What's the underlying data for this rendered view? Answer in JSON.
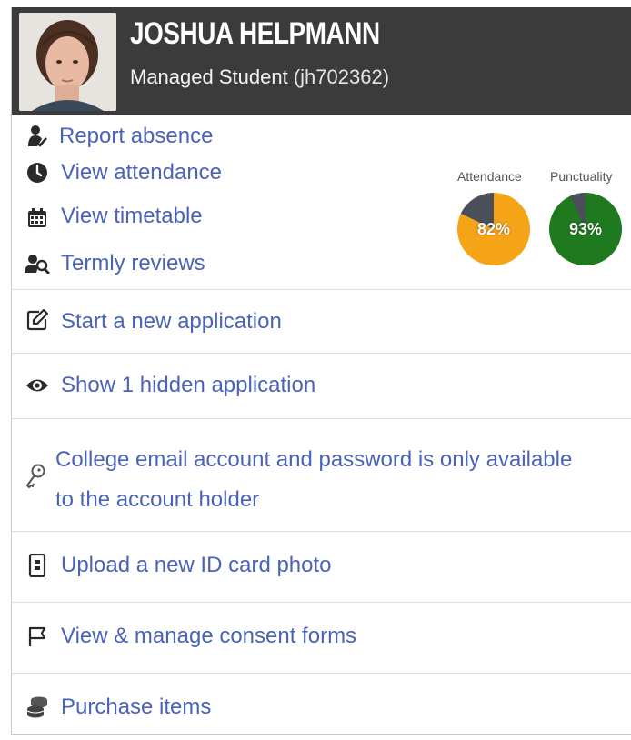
{
  "student": {
    "name": "JOSHUA HELPMANN",
    "role": "Managed Student",
    "id_text": "(jh702362)"
  },
  "quick_links": [
    {
      "label": "Report absence",
      "icon": "person-check-icon"
    },
    {
      "label": "View attendance",
      "icon": "clock-icon"
    },
    {
      "label": "View timetable",
      "icon": "calendar-icon"
    },
    {
      "label": "Termly reviews",
      "icon": "person-search-icon"
    }
  ],
  "stats": {
    "attendance": {
      "label": "Attendance",
      "value": 82,
      "text": "82%",
      "color": "#f5a418"
    },
    "punctuality": {
      "label": "Punctuality",
      "value": 93,
      "text": "93%",
      "color": "#1f7a1f"
    },
    "remainder_color": "#4a4f59"
  },
  "actions": [
    {
      "label": "Start a new application",
      "icon": "edit-icon"
    },
    {
      "label": "Show 1 hidden application",
      "icon": "eye-icon"
    },
    {
      "label_line1": "College email account and password is only available",
      "label_line2": "to the account holder",
      "icon": "key-icon"
    },
    {
      "label": "Upload a new ID card photo",
      "icon": "id-card-icon"
    },
    {
      "label": "View & manage consent forms",
      "icon": "flag-icon"
    },
    {
      "label": "Purchase items",
      "icon": "coins-icon"
    }
  ],
  "colors": {
    "header_bg": "#3b3b3b",
    "link": "#4a63b8"
  }
}
